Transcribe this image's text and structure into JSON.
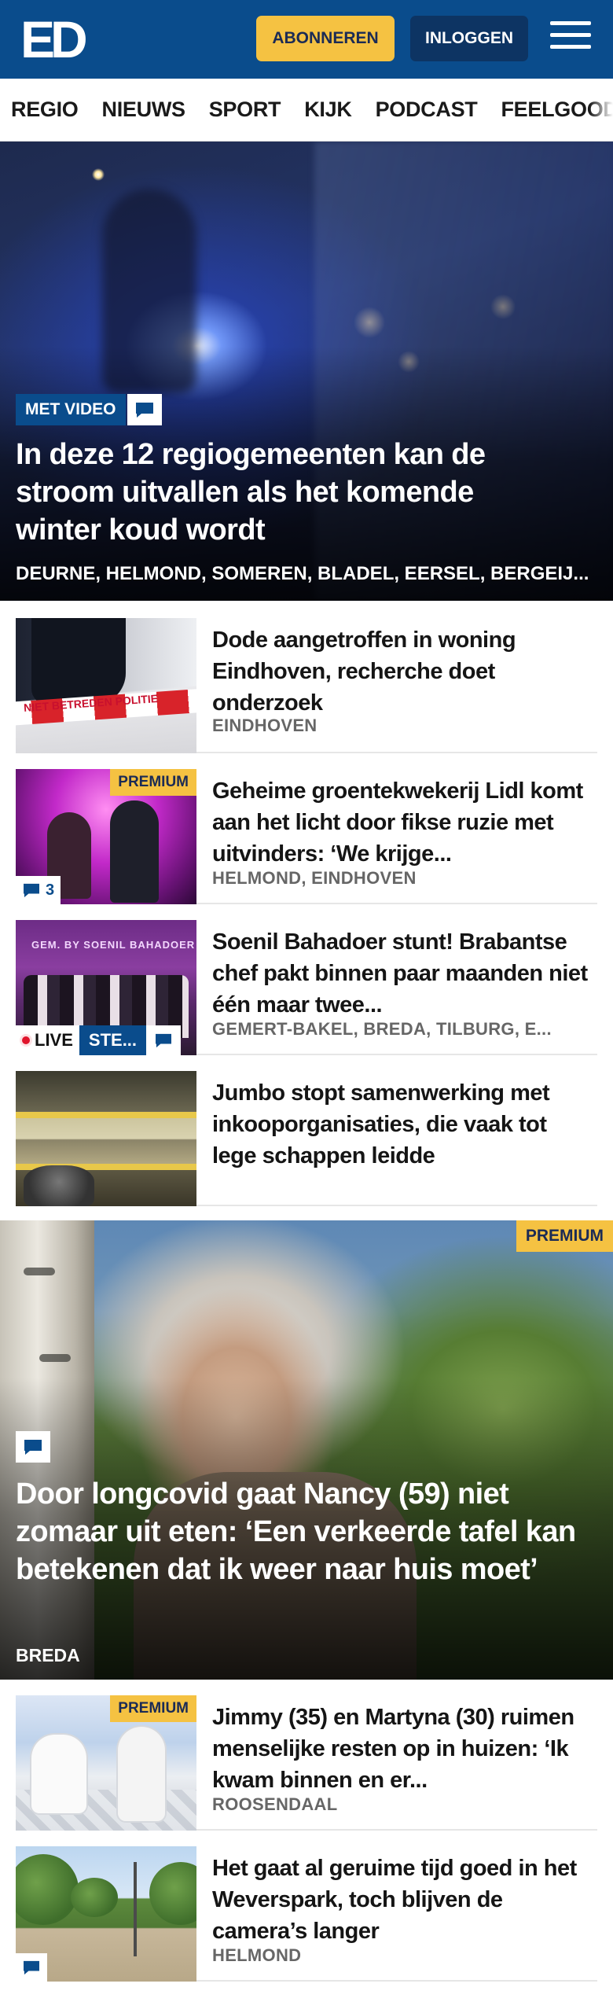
{
  "header": {
    "logo_text": "ED",
    "subscribe_label": "ABONNEREN",
    "login_label": "INLOGGEN",
    "menu_icon": "hamburger-menu-icon",
    "brand_color": "#0a4c8c",
    "accent_color": "#f5c242"
  },
  "nav": {
    "items": [
      "REGIO",
      "NIEUWS",
      "SPORT",
      "KIJK",
      "PODCAST",
      "FEELGOOD"
    ]
  },
  "hero": {
    "badge": "MET VIDEO",
    "comment_icon": "comment-icon",
    "title": "In deze 12 regiogemeenten kan de stroom uitvallen als het komende winter koud wordt",
    "places": "DEURNE, HELMOND, SOMEREN, BLADEL, EERSEL, BERGEIJ..."
  },
  "articles": [
    {
      "title": "Dode aangetroffen in woning Eindhoven, recherche doet onderzoek",
      "place": "EINDHOVEN",
      "thumb_text": "NIET BETREDEN POLITIE"
    },
    {
      "title": "Geheime groentekwekerij Lidl komt aan het licht door fikse ruzie met uitvinders: ‘We krijge...",
      "place": "HELMOND, EINDHOVEN",
      "premium": "PREMIUM",
      "comments": "3"
    },
    {
      "title": "Soenil Bahadoer stunt! Brabantse chef pakt binnen paar maanden niet één maar twee...",
      "place": "GEMERT-BAKEL, BREDA, TILBURG, E...",
      "live": "LIVE",
      "live_tag": "STE...",
      "thumb_text": "GEM. BY SOENIL BAHADOER"
    },
    {
      "title": "Jumbo stopt samenwerking met inkooporganisaties, die vaak tot lege schappen leidde",
      "place": ""
    }
  ],
  "featured": {
    "premium": "PREMIUM",
    "title": "Door longcovid gaat Nancy (59) niet zomaar uit eten: ‘Een verkeerde tafel kan betekenen dat ik weer naar huis moet’",
    "place": "BREDA"
  },
  "articles2": [
    {
      "title": "Jimmy (35) en Martyna (30) ruimen menselijke resten op in huizen: ‘Ik kwam binnen en er...",
      "place": "ROOSENDAAL",
      "premium": "PREMIUM"
    },
    {
      "title": "Het gaat al geruime tijd goed in het Weverspark, toch blijven de camera’s langer",
      "place": "HELMOND"
    }
  ]
}
